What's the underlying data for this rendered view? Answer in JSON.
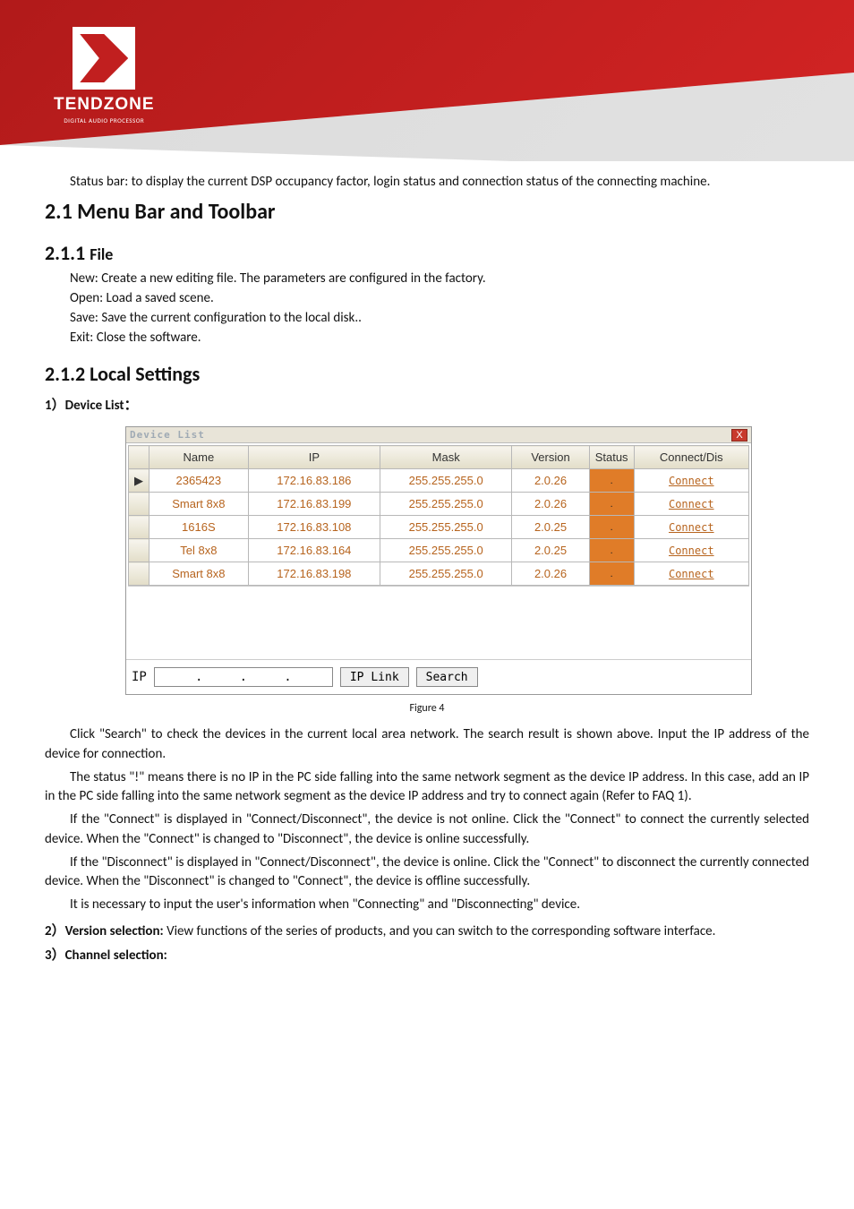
{
  "logo": {
    "name": "TENDZONE",
    "sub": "DIGITAL AUDIO PROCESSOR"
  },
  "intro": "Status bar: to display the current DSP occupancy factor, login status and connection status of the connecting machine.",
  "h_menu": "2.1 Menu Bar and Toolbar",
  "h_file_num": "2.1.1 ",
  "h_file_txt": "File",
  "file": {
    "new": "New: Create a new editing file. The parameters are configured in the factory.",
    "open": "Open: Load a saved scene.",
    "save": "Save: Save the current configuration to the local disk..",
    "exit": "Exit: Close the software."
  },
  "h_local": "2.1.2 Local Settings",
  "item1_prefix": "1）",
  "item1_label": "Device List：",
  "dlg": {
    "title": "Device List",
    "close": "X",
    "headers": {
      "sel": "",
      "name": "Name",
      "ip": "IP",
      "mask": "Mask",
      "version": "Version",
      "status": "Status",
      "conn": "Connect/Dis"
    },
    "rows": [
      {
        "sel": "▶",
        "name": "2365423",
        "ip": "172.16.83.186",
        "mask": "255.255.255.0",
        "version": "2.0.26",
        "status": ".",
        "conn": "Connect"
      },
      {
        "sel": "",
        "name": "Smart 8x8",
        "ip": "172.16.83.199",
        "mask": "255.255.255.0",
        "version": "2.0.26",
        "status": ".",
        "conn": "Connect"
      },
      {
        "sel": "",
        "name": "1616S",
        "ip": "172.16.83.108",
        "mask": "255.255.255.0",
        "version": "2.0.25",
        "status": ".",
        "conn": "Connect"
      },
      {
        "sel": "",
        "name": "Tel 8x8",
        "ip": "172.16.83.164",
        "mask": "255.255.255.0",
        "version": "2.0.25",
        "status": ".",
        "conn": "Connect"
      },
      {
        "sel": "",
        "name": "Smart 8x8",
        "ip": "172.16.83.198",
        "mask": "255.255.255.0",
        "version": "2.0.26",
        "status": ".",
        "conn": "Connect"
      }
    ],
    "ip_label": "IP",
    "ip_value": "",
    "btn_link": "IP Link",
    "btn_search": "Search"
  },
  "fig_caption": "Figure 4",
  "paras": {
    "p1": "Click \"Search\" to check the devices in the current local area network. The search result is shown above. Input the IP address of the device for connection.",
    "p2": "The status \"!\" means there is no IP in the PC side falling into the same network segment as the device IP address. In this case, add an IP in the PC side falling into the same network segment as the device IP address and try to connect again (Refer to FAQ 1).",
    "p3": "If the \"Connect\" is displayed in \"Connect/Disconnect\", the device is not online. Click the \"Connect\" to connect the currently selected device. When the \"Connect\" is changed to \"Disconnect\", the device is online successfully.",
    "p4": "If the \"Disconnect\" is displayed in \"Connect/Disconnect\", the device is online. Click the \"Connect\" to disconnect the currently connected device. When the \"Disconnect\" is changed to \"Connect\", the device is offline successfully.",
    "p5": "It is necessary to input the user's information when \"Connecting\" and \"Disconnecting\" device."
  },
  "item2_prefix": "2）",
  "item2_label": "Version selection: ",
  "item2_text": "View functions of the series of products, and you can switch to the corresponding software interface.",
  "item3_prefix": "3）",
  "item3_label": "Channel selection:"
}
